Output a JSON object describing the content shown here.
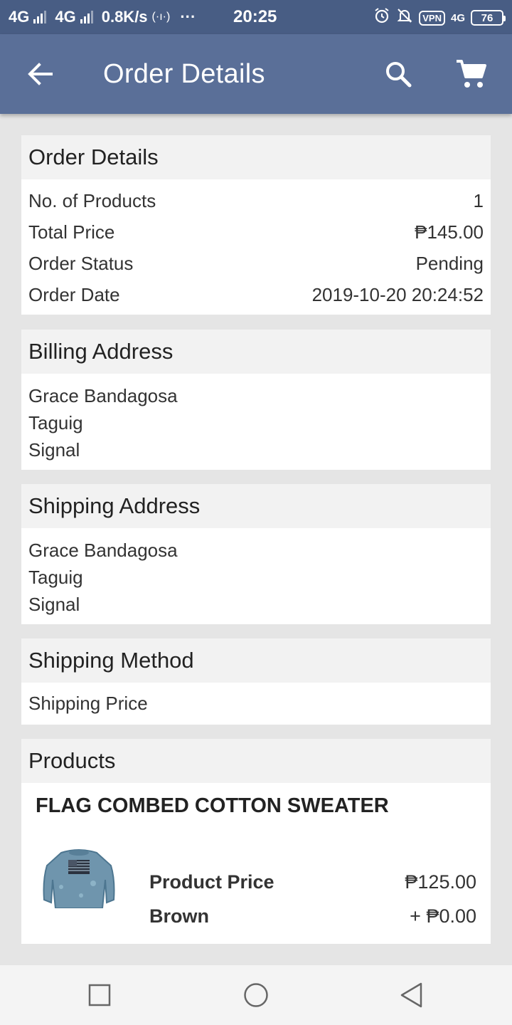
{
  "status_bar": {
    "net1": "4G",
    "net2": "4G",
    "speed": "0.8K/s",
    "dots": "···",
    "time": "20:25",
    "vpn": "VPN",
    "net3": "4G",
    "battery": "76"
  },
  "app_bar": {
    "title": "Order Details"
  },
  "order_details": {
    "title": "Order Details",
    "rows": [
      {
        "label": "No. of Products",
        "value": "1"
      },
      {
        "label": "Total Price",
        "value": "₱145.00"
      },
      {
        "label": "Order Status",
        "value": "Pending"
      },
      {
        "label": "Order Date",
        "value": "2019-10-20 20:24:52"
      }
    ]
  },
  "billing": {
    "title": "Billing Address",
    "lines": [
      "Grace Bandagosa",
      "Taguig",
      "Signal"
    ]
  },
  "shipping": {
    "title": "Shipping Address",
    "lines": [
      "Grace Bandagosa",
      "Taguig",
      "Signal"
    ]
  },
  "shipping_method": {
    "title": "Shipping Method",
    "row": "Shipping Price"
  },
  "products": {
    "title": "Products",
    "name": "FLAG COMBED COTTON SWEATER",
    "price_label": "Product Price",
    "price_value": "₱125.00",
    "option_label": "Brown",
    "option_value": "+ ₱0.00"
  },
  "icons": {
    "back": "arrow-back-icon",
    "search": "search-icon",
    "cart": "cart-icon",
    "recent": "square-icon",
    "home": "circle-icon",
    "nav_back": "triangle-back-icon"
  },
  "colors": {
    "status_bar": "#485d84",
    "app_bar": "#5a6f98",
    "background": "#e5e5e5",
    "card_header": "#f2f2f2"
  }
}
